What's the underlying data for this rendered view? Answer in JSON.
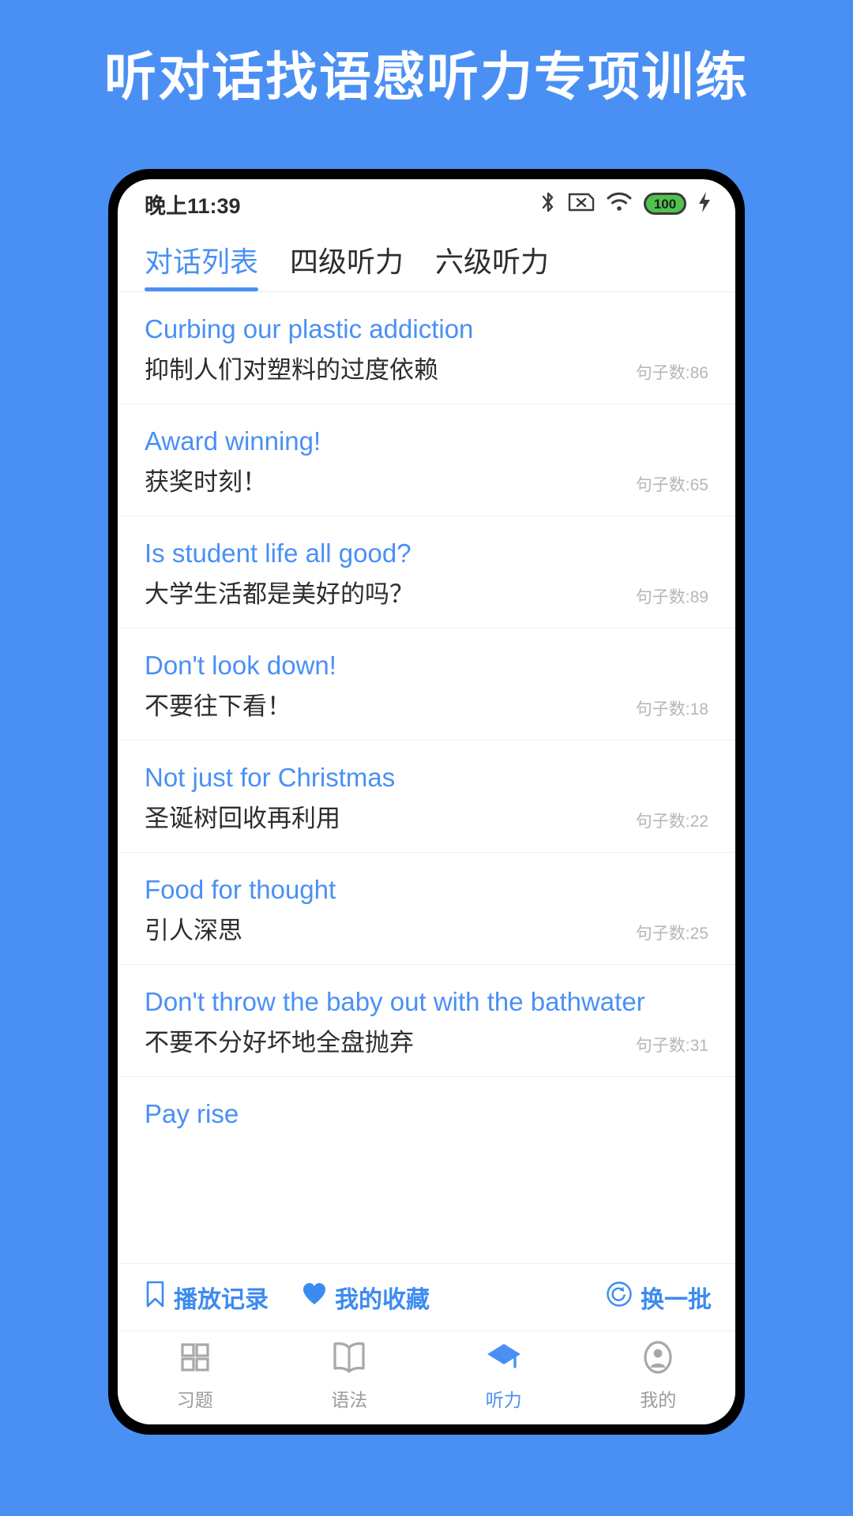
{
  "banner": {
    "title": "听对话找语感听力专项训练"
  },
  "colors": {
    "brand_blue": "#4a90f4",
    "link_blue": "#4a90f4",
    "battery_green": "#4ec24e",
    "muted_gray": "#b6b6b6"
  },
  "statusbar": {
    "time": "晚上11:39",
    "battery_level": "100",
    "icons": [
      "bluetooth-icon",
      "sim-card-off-icon",
      "wifi-icon",
      "battery-icon",
      "charging-bolt-icon"
    ]
  },
  "tabs": [
    {
      "label": "对话列表",
      "active": true
    },
    {
      "label": "四级听力",
      "active": false
    },
    {
      "label": "六级听力",
      "active": false
    }
  ],
  "list": {
    "count_prefix": "句子数:",
    "items": [
      {
        "title_en": "Curbing our plastic addiction",
        "title_zh": "抑制人们对塑料的过度依赖",
        "count": "句子数:86"
      },
      {
        "title_en": "Award winning!",
        "title_zh": "获奖时刻！",
        "count": "句子数:65"
      },
      {
        "title_en": "Is student life all good?",
        "title_zh": "大学生活都是美好的吗？",
        "count": "句子数:89"
      },
      {
        "title_en": "Don't look down!",
        "title_zh": "不要往下看！",
        "count": "句子数:18"
      },
      {
        "title_en": "Not just for Christmas",
        "title_zh": "圣诞树回收再利用",
        "count": "句子数:22"
      },
      {
        "title_en": "Food for thought",
        "title_zh": "引人深思",
        "count": "句子数:25"
      },
      {
        "title_en": "Don't throw the baby out with the bathwater",
        "title_zh": "不要不分好坏地全盘抛弃",
        "count": "句子数:31"
      },
      {
        "title_en": "Pay rise",
        "title_zh": "",
        "count": ""
      }
    ]
  },
  "actionbar": {
    "play_history": {
      "label": "播放记录",
      "icon": "bookmark-icon"
    },
    "my_favorites": {
      "label": "我的收藏",
      "icon": "heart-icon"
    },
    "refresh_batch": {
      "label": "换一批",
      "icon": "refresh-icon"
    }
  },
  "bottomnav": [
    {
      "label": "习题",
      "icon": "grid-icon",
      "active": false
    },
    {
      "label": "语法",
      "icon": "book-icon",
      "active": false
    },
    {
      "label": "听力",
      "icon": "graduation-cap-icon",
      "active": true
    },
    {
      "label": "我的",
      "icon": "user-circle-icon",
      "active": false
    }
  ]
}
